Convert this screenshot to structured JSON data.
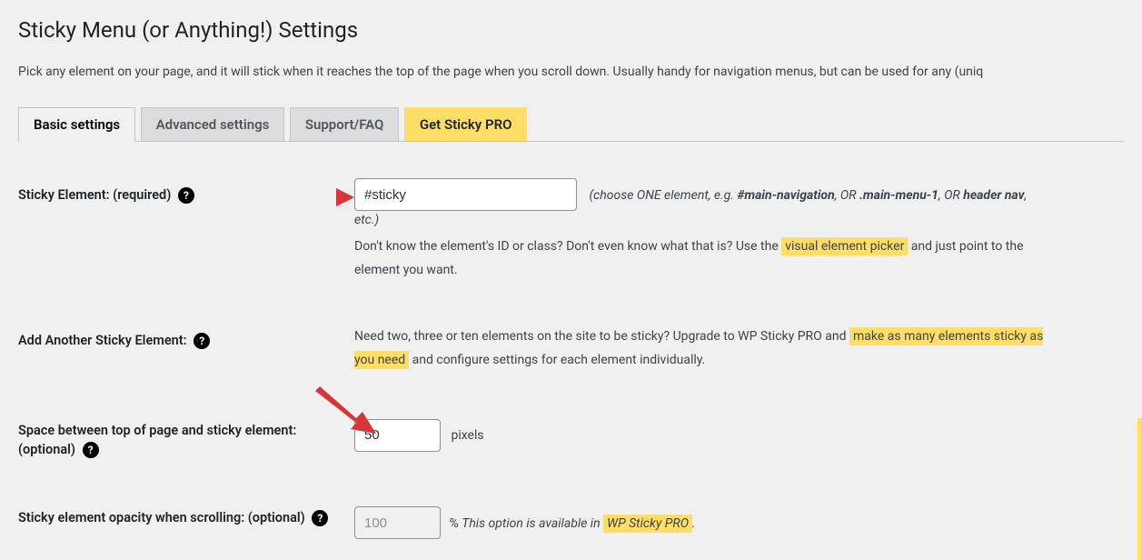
{
  "page": {
    "title": "Sticky Menu (or Anything!) Settings",
    "intro": "Pick any element on your page, and it will stick when it reaches the top of the page when you scroll down. Usually handy for navigation menus, but can be used for any (uniq"
  },
  "tabs": [
    {
      "label": "Basic settings",
      "active": true
    },
    {
      "label": "Advanced settings",
      "active": false
    },
    {
      "label": "Support/FAQ",
      "active": false
    },
    {
      "label": "Get Sticky PRO",
      "pro": true
    }
  ],
  "rows": {
    "sticky_element": {
      "label": "Sticky Element: (required)",
      "value": "#sticky",
      "hint_prefix": "(choose ONE element, e.g. ",
      "hint_bold1": "#main-navigation",
      "hint_mid": ", OR ",
      "hint_bold2": ".main-menu-1",
      "hint_mid2": ", OR ",
      "hint_bold3": "header nav",
      "hint_suffix": ", etc.)",
      "desc_pre": "Don't know the element's ID or class? Don't even know what that is? Use the ",
      "desc_hl": "visual element picker",
      "desc_post": " and just point to the element you want."
    },
    "add_another": {
      "label": "Add Another Sticky Element:",
      "desc_pre": "Need two, three or ten elements on the site to be sticky? Upgrade to WP Sticky PRO and ",
      "desc_hl": "make as many elements sticky as you need",
      "desc_post": " and configure settings for each element individually."
    },
    "space": {
      "label": "Space between top of page and sticky element: (optional)",
      "value": "50",
      "unit": "pixels"
    },
    "opacity": {
      "label": "Sticky element opacity when scrolling: (optional)",
      "value": "100",
      "unit_prefix": "% ",
      "unit_italic": "This option is available in ",
      "unit_hl": "WP Sticky PRO",
      "unit_post": "."
    }
  }
}
